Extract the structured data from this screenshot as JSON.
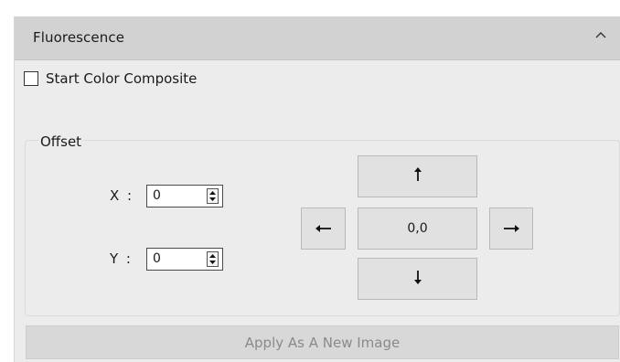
{
  "panel": {
    "title": "Fluorescence",
    "collapse_icon": "chevron-up-icon"
  },
  "color_composite": {
    "label": "Start Color Composite",
    "checked": false
  },
  "offset": {
    "group_label": "Offset",
    "x_label": "X :",
    "x_value": "0",
    "y_label": "Y :",
    "y_value": "0",
    "up_icon": "arrow-up-icon",
    "down_icon": "arrow-down-icon",
    "left_icon": "arrow-left-icon",
    "right_icon": "arrow-right-icon",
    "reset_label": "0,0"
  },
  "apply_button": {
    "label": "Apply As A New Image",
    "enabled": false
  }
}
